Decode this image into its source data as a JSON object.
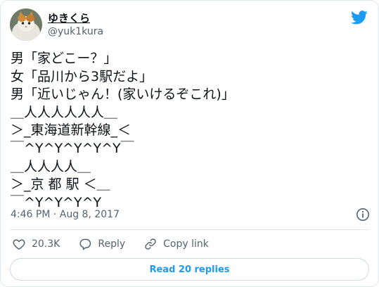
{
  "tweet": {
    "display_name": "ゆきくら",
    "handle": "@yuk1kura",
    "lines": [
      "男「家どこー？」",
      "女「品川から3駅だよ」",
      "男「近いじゃん！(家いけるぞこれ)」",
      "＿人人人人人人＿",
      "＞_東海道新幹線_＜",
      "￣^Y^Y^Y^Y^Y￣",
      "＿人人人人＿",
      "＞_京 都 駅 ＜＿",
      "￣^Y^Y^Y^Y"
    ],
    "timestamp": "4:46 PM · Aug 8, 2017"
  },
  "actions": {
    "likes": "20.3K",
    "reply_label": "Reply",
    "copy_link_label": "Copy link"
  },
  "read_replies_label": "Read 20 replies",
  "colors": {
    "accent": "#1d9bf0",
    "text": "#0f1419",
    "muted": "#536471",
    "border": "#e1e8ed"
  },
  "icons": [
    "avatar-cat",
    "twitter-bird-icon",
    "info-icon",
    "heart-icon",
    "reply-icon",
    "link-icon"
  ]
}
